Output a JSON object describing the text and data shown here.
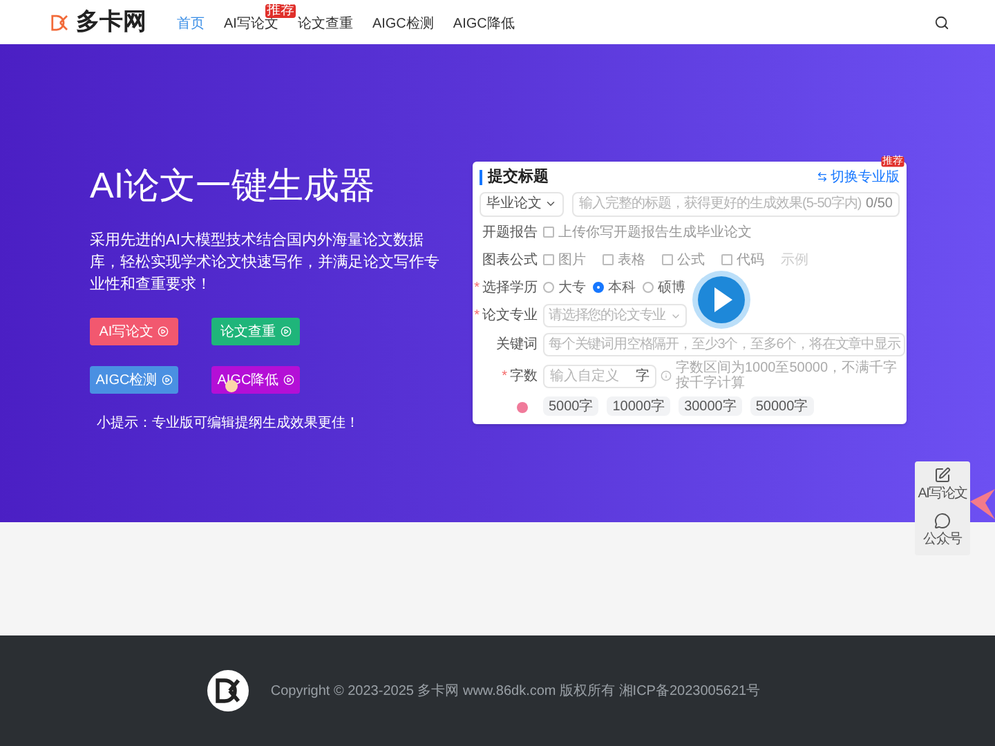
{
  "header": {
    "logo": "多卡网",
    "nav": [
      {
        "label": "首页",
        "selected": true
      },
      {
        "label": "AI写论文",
        "selected": false,
        "badge": "推荐"
      },
      {
        "label": "论文查重",
        "selected": false
      },
      {
        "label": "AIGC检测",
        "selected": false
      },
      {
        "label": "AIGC降低",
        "selected": false
      }
    ]
  },
  "hero": {
    "title": "AI论文一键生成器",
    "description": "采用先进的AI大模型技术结合国内外海量论文数据库，轻松实现学术论文快速写作，并满足论文写作专业性和查重要求！",
    "buttons": [
      {
        "label": "AI写论文",
        "color": "#f2586f"
      },
      {
        "label": "论文查重",
        "color": "#1fb57a"
      },
      {
        "label": "AIGC检测",
        "color": "#4a90e2"
      },
      {
        "label": "AIGC降低",
        "color": "#b40fd6"
      }
    ],
    "tip": "小提示：专业版可编辑提纲生成效果更佳！"
  },
  "mockup": {
    "title": "提交标题",
    "switch_label": "切换专业版",
    "badge": "推荐",
    "rows": [
      {
        "kind": "topic",
        "select": "毕业论文",
        "placeholder": "输入完整的标题，获得更好的生成效果(5-50字内)",
        "counter": "0/50"
      },
      {
        "kind": "checks",
        "label": "开题报告",
        "options": [
          {
            "label": "上传你写开题报告生成毕业论文",
            "checked": false
          }
        ]
      },
      {
        "kind": "checks",
        "label": "图表公式",
        "options": [
          {
            "label": "图片",
            "checked": false
          },
          {
            "label": "表格",
            "checked": false
          },
          {
            "label": "公式",
            "checked": false
          },
          {
            "label": "代码",
            "checked": false
          }
        ],
        "extra": "示例"
      },
      {
        "kind": "radios",
        "label": "选择学历",
        "marker": "*",
        "options": [
          {
            "label": "大专",
            "selected": false
          },
          {
            "label": "本科",
            "selected": true
          },
          {
            "label": "硕博",
            "selected": false
          }
        ]
      },
      {
        "kind": "select",
        "label": "论文专业",
        "marker": "*",
        "placeholder": "请选择您的论文专业"
      },
      {
        "kind": "input",
        "label": "关键词",
        "placeholder": "每个关键词用空格隔开，至少3个，至多6个，将在文章中显示"
      },
      {
        "kind": "words",
        "label": "字数",
        "marker": "*",
        "placeholder": "输入自定义",
        "unit": "字",
        "hint": "字数区间为1000至50000，不满千字按千字计算"
      },
      {
        "kind": "chips",
        "chips": [
          "5000字",
          "10000字",
          "30000字",
          "50000字"
        ]
      }
    ]
  },
  "float_bar": [
    {
      "label": "AI写论文",
      "kind": "edit"
    },
    {
      "label": "公众号",
      "kind": "chat"
    }
  ],
  "footer": {
    "copyright": "Copyright © 2023-2025 多卡网 www.86dk.com 版权所有 湘ICP备2023005621号"
  }
}
